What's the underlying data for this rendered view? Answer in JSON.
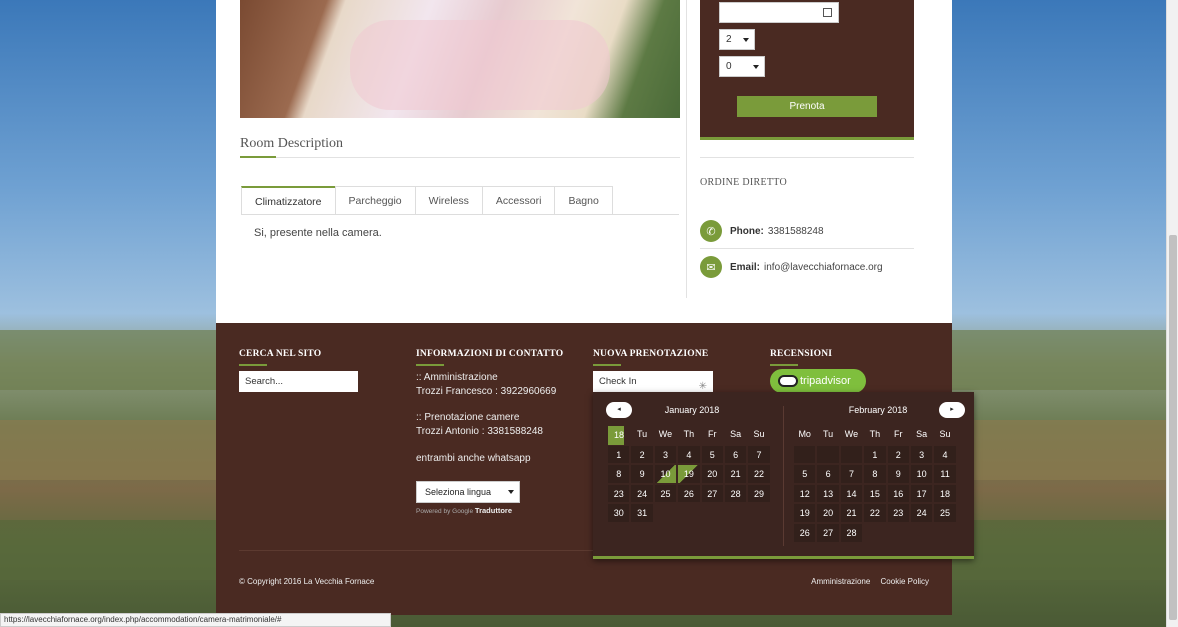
{
  "room": {
    "title": "Room Description",
    "tabs": [
      "Climatizzatore",
      "Parcheggio",
      "Wireless",
      "Accessori",
      "Bagno"
    ],
    "active_tab": "Climatizzatore",
    "tab_content": "Si, presente nella camera."
  },
  "booking": {
    "adults_value": "2",
    "children_value": "0",
    "submit_label": "Prenota"
  },
  "sidebar": {
    "ordine_title": "ORDINE DIRETTO",
    "phone_label": "Phone:",
    "phone_value": "3381588248",
    "email_label": "Email:",
    "email_value": "info@lavecchiafornace.org"
  },
  "footer": {
    "search_title": "CERCA NEL SITO",
    "search_placeholder": "Search...",
    "info_title": "INFORMAZIONI DI CONTATTO",
    "info_line1": ":: Amministrazione",
    "info_line2": "Trozzi Francesco : 3922960669",
    "info_line3": ":: Prenotazione camere",
    "info_line4": "Trozzi Antonio : 3381588248",
    "info_line5": "entrambi anche whatsapp",
    "lang_select": "Seleziona lingua",
    "powered_by": "Powered by",
    "google": "Google",
    "translator": "Traduttore",
    "booking_title": "NUOVA PRENOTAZIONE",
    "checkin_placeholder": "Check In",
    "reviews_title": "RECENSIONI",
    "tripadvisor": "tripadvisor",
    "copyright": "© Copyright 2016 La Vecchia Fornace",
    "link_admin": "Amministrazione",
    "link_cookie": "Cookie Policy"
  },
  "calendar": {
    "prev_label": "◂",
    "next_label": "▸",
    "weekdays": [
      "Mo",
      "Tu",
      "We",
      "Th",
      "Fr",
      "Sa",
      "Su"
    ],
    "months": [
      {
        "name": "January 2018",
        "lead_empty": 0,
        "days": 31,
        "selected_from": 10,
        "selected_to": 19
      },
      {
        "name": "February 2018",
        "lead_empty": 3,
        "days": 28,
        "selected_from": 0,
        "selected_to": 0
      }
    ]
  },
  "status_bar": "https://lavecchiafornace.org/index.php/accommodation/camera-matrimoniale/#"
}
